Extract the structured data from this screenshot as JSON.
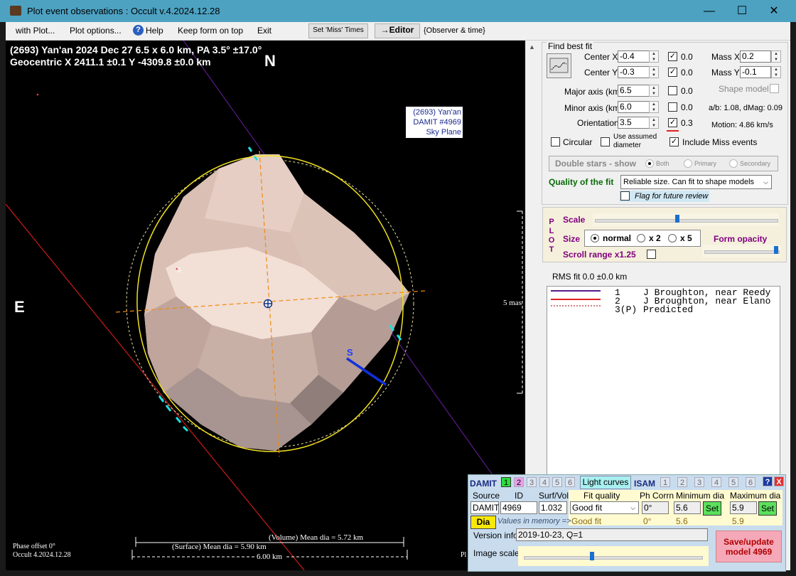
{
  "window": {
    "title": "Plot event observations : Occult v.4.2024.12.28"
  },
  "menu": {
    "with_plot": "with Plot...",
    "plot_options": "Plot options...",
    "help": "Help",
    "keep_on_top": "Keep form on top",
    "exit": "Exit",
    "set_miss": "Set 'Miss' Times",
    "editor": "→Editor",
    "observer_time": "{Observer & time}"
  },
  "plot": {
    "header1": "(2693) Yan'an  2024 Dec 27  6.5 x 6.0 km, PA 3.5° ±17.0°",
    "header2": "Geocentric  X  2411.1 ±0.1  Y -4309.8 ±0.0 km",
    "north": "N",
    "east": "E",
    "south_mark": "S",
    "label_line1": "(2693) Yan'an",
    "label_line2": "DAMIT #4969",
    "label_line3": "Sky Plane",
    "scale_mas": "5 mas",
    "volume_dia": "(Volume) Mean dia = 5.72 km",
    "surface_dia": "(Surface) Mean dia = 5.90 km",
    "km_scale": "6.00 km",
    "phase_offset": "Phase offset 0°",
    "version": "Occult 4.2024.12.28",
    "corner": "Pl",
    "small_mark": "3"
  },
  "fit": {
    "group_title": "Find best fit",
    "center_x_label": "Center X",
    "center_x": "-0.4",
    "center_x_fixed": "0.0",
    "center_y_label": "Center Y",
    "center_y": "-0.3",
    "center_y_fixed": "0.0",
    "mass_x_label": "Mass X",
    "mass_x": "0.2",
    "mass_y_label": "Mass Y",
    "mass_y": "-0.1",
    "major_label": "Major axis (km)",
    "major": "6.5",
    "major_fixed": "0.0",
    "minor_label": "Minor axis (km)",
    "minor": "6.0",
    "minor_fixed": "0.0",
    "orient_label": "Orientation",
    "orient": "3.5",
    "orient_fixed": "0.3",
    "shape_model": "Shape model",
    "ab_dmag": "a/b: 1.08, dMag: 0.09",
    "motion": "Motion: 4.86 km/s",
    "circular": "Circular",
    "use_assumed1": "Use assumed",
    "use_assumed2": "diameter",
    "include_miss": "Include Miss events",
    "double_stars": "Double stars - show",
    "both": "Both",
    "primary": "Primary",
    "secondary": "Secondary",
    "quality_label": "Quality of the fit",
    "quality_value": "Reliable size. Can fit to shape models",
    "flag_review": "Flag for future review"
  },
  "plot_ctrl": {
    "letters": [
      "P",
      "L",
      "O",
      "T"
    ],
    "scale": "Scale",
    "size": "Size",
    "normal": "normal",
    "x2": "x 2",
    "x5": "x 5",
    "form_opacity": "Form opacity",
    "scroll_range": "Scroll range x1.25",
    "scale_fraction": 0.45,
    "opacity_fraction": 1.0
  },
  "rms": "RMS fit 0.0 ±0.0 km",
  "legend": [
    {
      "num": "1",
      "text": "J Broughton, near Reedy",
      "color": "#5a1a8a"
    },
    {
      "num": "2",
      "text": "J Broughton, near Elano",
      "color": "#e02020"
    },
    {
      "num": "3(P)",
      "text": "Predicted",
      "color": "#d08080"
    }
  ],
  "damit": {
    "damit_label": "DAMIT",
    "damit_nums": [
      "1",
      "2",
      "3",
      "4",
      "5",
      "6"
    ],
    "light_curves": "Light curves",
    "isam_label": "ISAM",
    "isam_nums": [
      "1",
      "2",
      "3",
      "4",
      "5",
      "6"
    ],
    "help": "?",
    "close": "X",
    "source_h": "Source",
    "id_h": "ID",
    "surf_h": "Surf/Vol",
    "fitq_h": "Fit quality",
    "phcorr_h": "Ph Corrn",
    "mindia_h": "Minimum dia",
    "maxdia_h": "Maximum dia",
    "source": "DAMIT",
    "id": "4969",
    "surf": "1.032",
    "fitq": "Good fit",
    "phcorr": "0°",
    "mindia": "5.6",
    "maxdia": "5.9",
    "set": "Set",
    "dia": "Dia",
    "values_mem": "Values in memory =>",
    "mem_fitq": "Good fit",
    "mem_ph": "0°",
    "mem_min": "5.6",
    "mem_max": "5.9",
    "version_label": "Version info",
    "version_value": "2019-10-23, Q=1",
    "image_scale": "Image scale",
    "image_scale_fraction": 0.38,
    "save1": "Save/update",
    "save2": "model 4969"
  }
}
